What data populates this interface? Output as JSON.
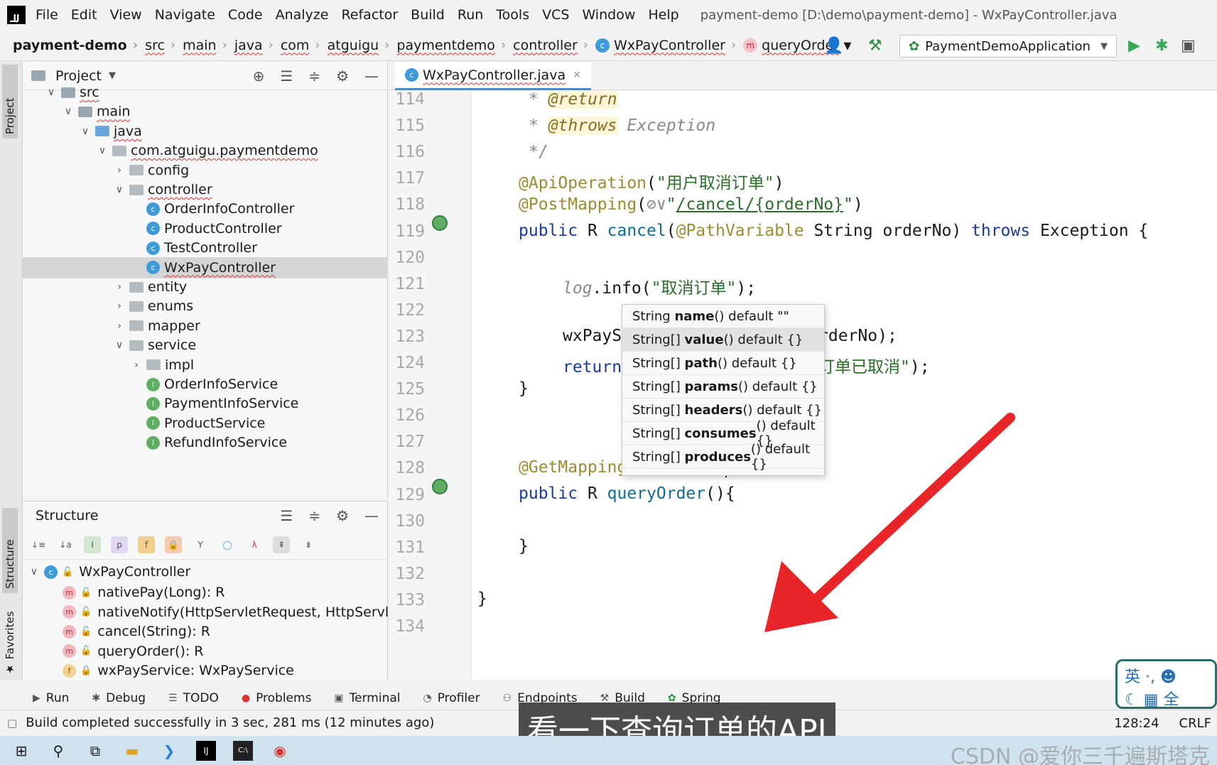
{
  "menu": [
    "File",
    "Edit",
    "View",
    "Navigate",
    "Code",
    "Analyze",
    "Refactor",
    "Build",
    "Run",
    "Tools",
    "VCS",
    "Window",
    "Help"
  ],
  "window_title": "payment-demo [D:\\demo\\payment-demo] - WxPayController.java",
  "breadcrumbs": [
    "payment-demo",
    "src",
    "main",
    "java",
    "com",
    "atguigu",
    "paymentdemo",
    "controller",
    "WxPayController",
    "queryOrder"
  ],
  "run_config": "PaymentDemoApplication",
  "project_panel": {
    "title": "Project",
    "tree": [
      {
        "label": "src",
        "level": 0,
        "arrow": "down",
        "icon": "folder"
      },
      {
        "label": "main",
        "level": 1,
        "arrow": "down",
        "icon": "folder"
      },
      {
        "label": "java",
        "level": 2,
        "arrow": "down",
        "icon": "folder-blue"
      },
      {
        "label": "com.atguigu.paymentdemo",
        "level": 3,
        "arrow": "down",
        "icon": "package"
      },
      {
        "label": "config",
        "level": 4,
        "arrow": "right",
        "icon": "package"
      },
      {
        "label": "controller",
        "level": 4,
        "arrow": "down",
        "icon": "package"
      },
      {
        "label": "OrderInfoController",
        "level": 5,
        "arrow": "",
        "icon": "class"
      },
      {
        "label": "ProductController",
        "level": 5,
        "arrow": "",
        "icon": "class"
      },
      {
        "label": "TestController",
        "level": 5,
        "arrow": "",
        "icon": "class"
      },
      {
        "label": "WxPayController",
        "level": 5,
        "arrow": "",
        "icon": "class",
        "selected": true
      },
      {
        "label": "entity",
        "level": 4,
        "arrow": "right",
        "icon": "package"
      },
      {
        "label": "enums",
        "level": 4,
        "arrow": "right",
        "icon": "package"
      },
      {
        "label": "mapper",
        "level": 4,
        "arrow": "right",
        "icon": "package"
      },
      {
        "label": "service",
        "level": 4,
        "arrow": "down",
        "icon": "package"
      },
      {
        "label": "impl",
        "level": 5,
        "arrow": "right",
        "icon": "package"
      },
      {
        "label": "OrderInfoService",
        "level": 5,
        "arrow": "",
        "icon": "interface"
      },
      {
        "label": "PaymentInfoService",
        "level": 5,
        "arrow": "",
        "icon": "interface"
      },
      {
        "label": "ProductService",
        "level": 5,
        "arrow": "",
        "icon": "interface"
      },
      {
        "label": "RefundInfoService",
        "level": 5,
        "arrow": "",
        "icon": "interface"
      }
    ]
  },
  "structure_panel": {
    "title": "Structure",
    "root": "WxPayController",
    "members": [
      {
        "label": "nativePay(Long): R",
        "icon": "m"
      },
      {
        "label": "nativeNotify(HttpServletRequest, HttpServletRe",
        "icon": "m"
      },
      {
        "label": "cancel(String): R",
        "icon": "m"
      },
      {
        "label": "queryOrder(): R",
        "icon": "m"
      },
      {
        "label": "wxPayService: WxPayService",
        "icon": "f"
      }
    ]
  },
  "editor": {
    "tab": "WxPayController.java",
    "line_numbers": [
      "114",
      "115",
      "116",
      "117",
      "118",
      "119",
      "120",
      "121",
      "122",
      "123",
      "124",
      "125",
      "126",
      "127",
      "128",
      "129",
      "130",
      "131",
      "132",
      "133",
      "134"
    ]
  },
  "popup": [
    {
      "pre": "String ",
      "name": "name",
      "post": "() default \"\""
    },
    {
      "pre": "String[] ",
      "name": "value",
      "post": "() default {}"
    },
    {
      "pre": "String[] ",
      "name": "path",
      "post": "() default {}"
    },
    {
      "pre": "String[] ",
      "name": "params",
      "post": "() default {}"
    },
    {
      "pre": "String[] ",
      "name": "headers",
      "post": "() default {}"
    },
    {
      "pre": "String[] ",
      "name": "consumes",
      "post": "() default {}"
    },
    {
      "pre": "String[] ",
      "name": "produces",
      "post": "() default {}"
    }
  ],
  "bottom_tools": [
    "Run",
    "Debug",
    "TODO",
    "Problems",
    "Terminal",
    "Profiler",
    "Endpoints",
    "Build",
    "Spring"
  ],
  "status": {
    "message": "Build completed successfully in 3 sec, 281 ms (12 minutes ago)",
    "position": "128:24",
    "line_sep": "CRLF"
  },
  "subtitle": "看一下查询订单的API",
  "ime": {
    "line1": "英 ·, ☻",
    "line2": "☾ ▦ 全"
  },
  "watermark": "CSDN @爱你三千遍斯塔克"
}
